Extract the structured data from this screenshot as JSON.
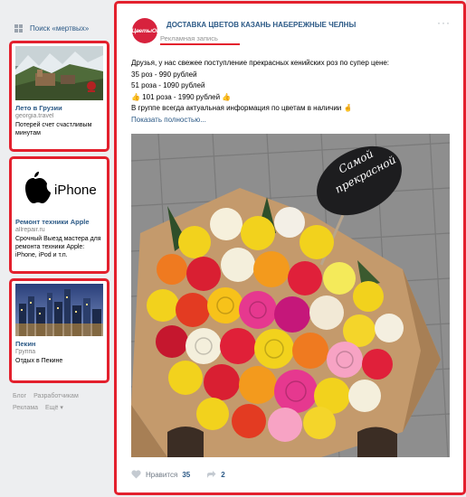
{
  "left": {
    "search_label": "Поиск «мертвых»",
    "ads": [
      {
        "title": "Лето в Грузии",
        "site": "georgia.travel",
        "text": "Потерей счет счастливым минутам"
      },
      {
        "image_text": "iPhone",
        "title": "Ремонт техники Apple",
        "site": "allrepair.ru",
        "text": "Срочный Выезд мастера для ремонта техники Apple: iPhone, iPod и т.п."
      },
      {
        "title": "Пекин",
        "site": "Группа",
        "text": "Отдых в Пекине"
      }
    ],
    "footer": [
      "Блог",
      "Разработчикам",
      "Реклама",
      "Ещё ▾"
    ]
  },
  "post": {
    "avatar_text": "#ЦветыОМ",
    "author": "ДОСТАВКА ЦВЕТОВ КАЗАНЬ НАБЕРЕЖНЫЕ ЧЕЛНЫ",
    "meta": "Рекламная запись",
    "lines": [
      "Друзья, у нас свежее поступление прекрасных кенийских роз по супер цене:",
      "35 роз - 990 рублей",
      "51 роза - 1090 рублей",
      "👍 101 роза - 1990 рублей 👍",
      "В группе всегда актуальная информация по цветам в наличии 🤞"
    ],
    "show_more": "Показать полностью...",
    "sign_text": [
      "Самой",
      "прекрасной"
    ],
    "likes_label": "Нравится",
    "likes_count": "35",
    "reposts_count": "2"
  },
  "colors": {
    "link": "#2a5885",
    "highlight_border": "#e3202d",
    "page_bg": "#edeef0",
    "avatar": "#d7223d"
  },
  "icons": [
    "grid-icon",
    "more-icon",
    "heart-icon",
    "share-icon"
  ]
}
